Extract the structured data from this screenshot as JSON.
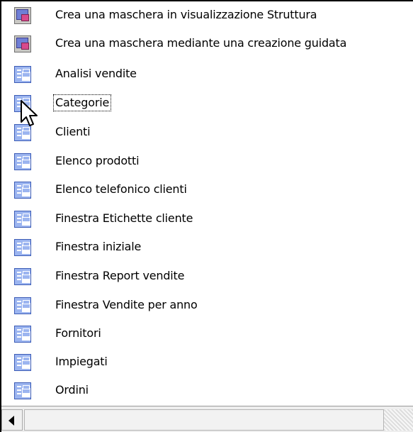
{
  "list": {
    "items": [
      {
        "icon": "form-wizard-icon",
        "label": "Crea una maschera in visualizzazione Struttura"
      },
      {
        "icon": "form-wizard-icon",
        "label": "Crea una maschera mediante una creazione guidata"
      },
      {
        "icon": "form-icon",
        "label": "Analisi vendite"
      },
      {
        "icon": "form-icon",
        "label": "Categorie",
        "focused": true
      },
      {
        "icon": "form-icon",
        "label": "Clienti"
      },
      {
        "icon": "form-icon",
        "label": "Elenco prodotti"
      },
      {
        "icon": "form-icon",
        "label": "Elenco telefonico clienti"
      },
      {
        "icon": "form-icon",
        "label": "Finestra Etichette cliente"
      },
      {
        "icon": "form-icon",
        "label": "Finestra iniziale"
      },
      {
        "icon": "form-icon",
        "label": "Finestra Report vendite"
      },
      {
        "icon": "form-icon",
        "label": "Finestra Vendite per anno"
      },
      {
        "icon": "form-icon",
        "label": "Fornitori"
      },
      {
        "icon": "form-icon",
        "label": "Impiegati"
      },
      {
        "icon": "form-icon",
        "label": "Ordini"
      }
    ]
  },
  "scrollbar": {
    "left_arrow_icon": "arrow-left-icon"
  }
}
